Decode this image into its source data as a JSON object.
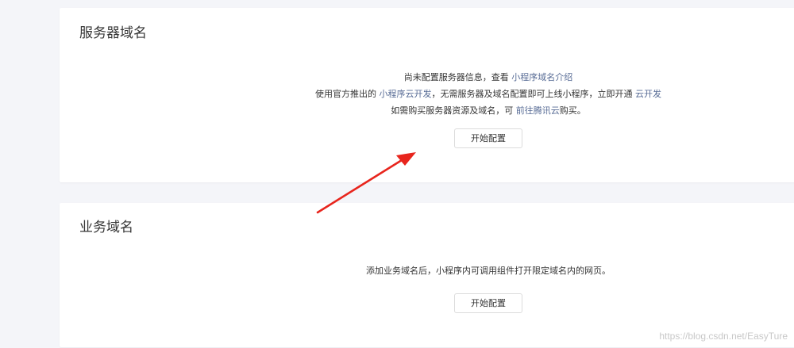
{
  "server_domain": {
    "title": "服务器域名",
    "line1_text": "尚未配置服务器信息，查看",
    "line1_link": "小程序域名介绍",
    "line2_prefix": "使用官方推出的",
    "line2_link1": "小程序云开发",
    "line2_middle": "，无需服务器及域名配置即可上线小程序，立即开通",
    "line2_link2": "云开发",
    "line3_prefix": "如需购买服务器资源及域名，可",
    "line3_link": "前往腾讯云",
    "line3_suffix": "购买。",
    "button_label": "开始配置"
  },
  "business_domain": {
    "title": "业务域名",
    "description": "添加业务域名后，小程序内可调用组件打开限定域名内的网页。",
    "button_label": "开始配置"
  },
  "annotation": {
    "arrow_color": "#e8251d"
  },
  "watermark": "https://blog.csdn.net/EasyTure",
  "colors": {
    "link": "#576b95",
    "background": "#f4f5f9",
    "card": "#ffffff"
  }
}
